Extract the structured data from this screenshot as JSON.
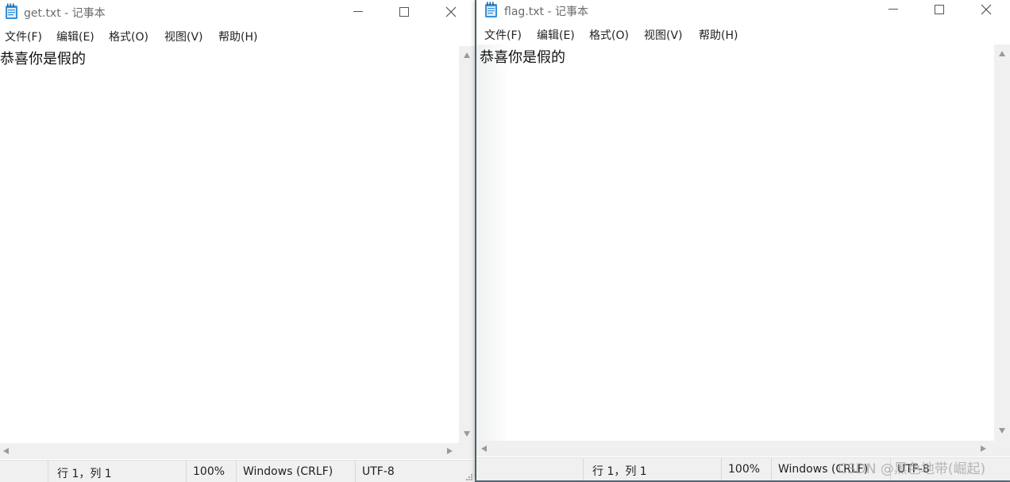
{
  "windows": [
    {
      "title": "get.txt - 记事本",
      "menu": [
        "文件(F)",
        "编辑(E)",
        "格式(O)",
        "视图(V)",
        "帮助(H)"
      ],
      "content": "恭喜你是假的",
      "status": {
        "position": "行 1，列 1",
        "zoom": "100%",
        "line_endings": "Windows (CRLF)",
        "encoding": "UTF-8"
      }
    },
    {
      "title": "flag.txt - 记事本",
      "menu": [
        "文件(F)",
        "编辑(E)",
        "格式(O)",
        "视图(V)",
        "帮助(H)"
      ],
      "content": "恭喜你是假的",
      "status": {
        "position": "行 1，列 1",
        "zoom": "100%",
        "line_endings": "Windows (CRLF)",
        "encoding": "UTF-8"
      }
    }
  ],
  "watermark": "CSDN @黑色地带(崛起)",
  "icons": {
    "app": "notepad-icon",
    "minimize": "minimize-icon",
    "maximize": "maximize-icon",
    "close": "close-icon"
  },
  "colors": {
    "scrollbar": "#f0f0f0",
    "status_bar": "#f0f0f0",
    "desktop": "#5b6f7a"
  }
}
